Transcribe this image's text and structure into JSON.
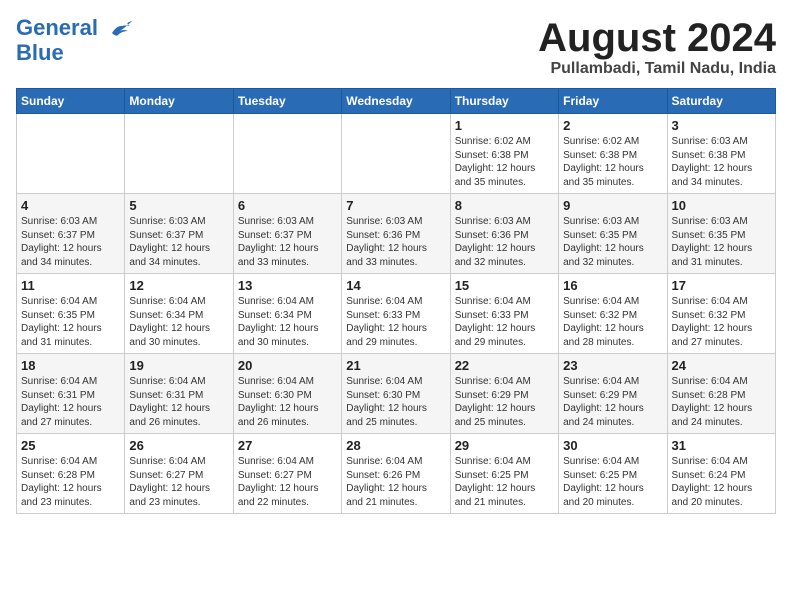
{
  "header": {
    "logo_line1": "General",
    "logo_line2": "Blue",
    "month_year": "August 2024",
    "location": "Pullambadi, Tamil Nadu, India"
  },
  "days_of_week": [
    "Sunday",
    "Monday",
    "Tuesday",
    "Wednesday",
    "Thursday",
    "Friday",
    "Saturday"
  ],
  "weeks": [
    [
      {
        "day": "",
        "info": ""
      },
      {
        "day": "",
        "info": ""
      },
      {
        "day": "",
        "info": ""
      },
      {
        "day": "",
        "info": ""
      },
      {
        "day": "1",
        "info": "Sunrise: 6:02 AM\nSunset: 6:38 PM\nDaylight: 12 hours\nand 35 minutes."
      },
      {
        "day": "2",
        "info": "Sunrise: 6:02 AM\nSunset: 6:38 PM\nDaylight: 12 hours\nand 35 minutes."
      },
      {
        "day": "3",
        "info": "Sunrise: 6:03 AM\nSunset: 6:38 PM\nDaylight: 12 hours\nand 34 minutes."
      }
    ],
    [
      {
        "day": "4",
        "info": "Sunrise: 6:03 AM\nSunset: 6:37 PM\nDaylight: 12 hours\nand 34 minutes."
      },
      {
        "day": "5",
        "info": "Sunrise: 6:03 AM\nSunset: 6:37 PM\nDaylight: 12 hours\nand 34 minutes."
      },
      {
        "day": "6",
        "info": "Sunrise: 6:03 AM\nSunset: 6:37 PM\nDaylight: 12 hours\nand 33 minutes."
      },
      {
        "day": "7",
        "info": "Sunrise: 6:03 AM\nSunset: 6:36 PM\nDaylight: 12 hours\nand 33 minutes."
      },
      {
        "day": "8",
        "info": "Sunrise: 6:03 AM\nSunset: 6:36 PM\nDaylight: 12 hours\nand 32 minutes."
      },
      {
        "day": "9",
        "info": "Sunrise: 6:03 AM\nSunset: 6:35 PM\nDaylight: 12 hours\nand 32 minutes."
      },
      {
        "day": "10",
        "info": "Sunrise: 6:03 AM\nSunset: 6:35 PM\nDaylight: 12 hours\nand 31 minutes."
      }
    ],
    [
      {
        "day": "11",
        "info": "Sunrise: 6:04 AM\nSunset: 6:35 PM\nDaylight: 12 hours\nand 31 minutes."
      },
      {
        "day": "12",
        "info": "Sunrise: 6:04 AM\nSunset: 6:34 PM\nDaylight: 12 hours\nand 30 minutes."
      },
      {
        "day": "13",
        "info": "Sunrise: 6:04 AM\nSunset: 6:34 PM\nDaylight: 12 hours\nand 30 minutes."
      },
      {
        "day": "14",
        "info": "Sunrise: 6:04 AM\nSunset: 6:33 PM\nDaylight: 12 hours\nand 29 minutes."
      },
      {
        "day": "15",
        "info": "Sunrise: 6:04 AM\nSunset: 6:33 PM\nDaylight: 12 hours\nand 29 minutes."
      },
      {
        "day": "16",
        "info": "Sunrise: 6:04 AM\nSunset: 6:32 PM\nDaylight: 12 hours\nand 28 minutes."
      },
      {
        "day": "17",
        "info": "Sunrise: 6:04 AM\nSunset: 6:32 PM\nDaylight: 12 hours\nand 27 minutes."
      }
    ],
    [
      {
        "day": "18",
        "info": "Sunrise: 6:04 AM\nSunset: 6:31 PM\nDaylight: 12 hours\nand 27 minutes."
      },
      {
        "day": "19",
        "info": "Sunrise: 6:04 AM\nSunset: 6:31 PM\nDaylight: 12 hours\nand 26 minutes."
      },
      {
        "day": "20",
        "info": "Sunrise: 6:04 AM\nSunset: 6:30 PM\nDaylight: 12 hours\nand 26 minutes."
      },
      {
        "day": "21",
        "info": "Sunrise: 6:04 AM\nSunset: 6:30 PM\nDaylight: 12 hours\nand 25 minutes."
      },
      {
        "day": "22",
        "info": "Sunrise: 6:04 AM\nSunset: 6:29 PM\nDaylight: 12 hours\nand 25 minutes."
      },
      {
        "day": "23",
        "info": "Sunrise: 6:04 AM\nSunset: 6:29 PM\nDaylight: 12 hours\nand 24 minutes."
      },
      {
        "day": "24",
        "info": "Sunrise: 6:04 AM\nSunset: 6:28 PM\nDaylight: 12 hours\nand 24 minutes."
      }
    ],
    [
      {
        "day": "25",
        "info": "Sunrise: 6:04 AM\nSunset: 6:28 PM\nDaylight: 12 hours\nand 23 minutes."
      },
      {
        "day": "26",
        "info": "Sunrise: 6:04 AM\nSunset: 6:27 PM\nDaylight: 12 hours\nand 23 minutes."
      },
      {
        "day": "27",
        "info": "Sunrise: 6:04 AM\nSunset: 6:27 PM\nDaylight: 12 hours\nand 22 minutes."
      },
      {
        "day": "28",
        "info": "Sunrise: 6:04 AM\nSunset: 6:26 PM\nDaylight: 12 hours\nand 21 minutes."
      },
      {
        "day": "29",
        "info": "Sunrise: 6:04 AM\nSunset: 6:25 PM\nDaylight: 12 hours\nand 21 minutes."
      },
      {
        "day": "30",
        "info": "Sunrise: 6:04 AM\nSunset: 6:25 PM\nDaylight: 12 hours\nand 20 minutes."
      },
      {
        "day": "31",
        "info": "Sunrise: 6:04 AM\nSunset: 6:24 PM\nDaylight: 12 hours\nand 20 minutes."
      }
    ]
  ]
}
